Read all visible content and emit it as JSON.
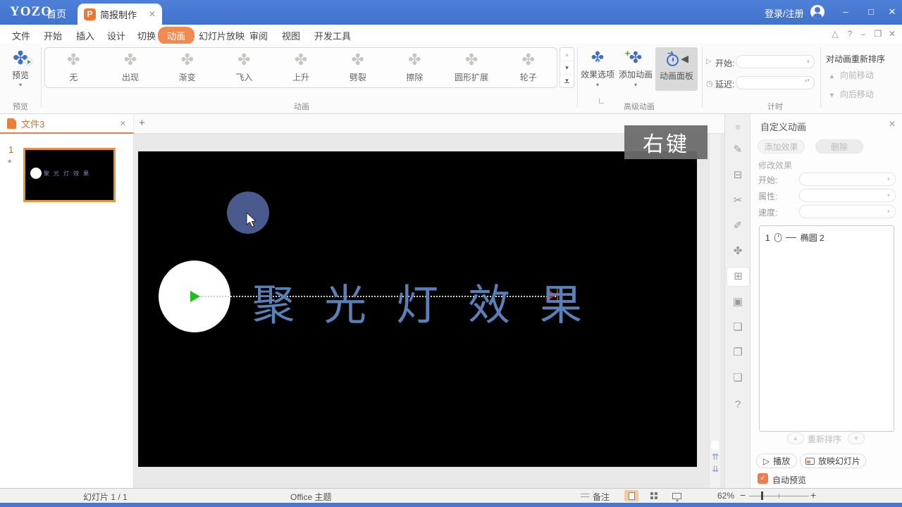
{
  "titlebar": {
    "logo": "YOZO",
    "home": "首页",
    "doc_tab": "简报制作",
    "login": "登录/注册"
  },
  "menubar": {
    "items": [
      "文件",
      "开始",
      "插入",
      "设计",
      "切换",
      "动画",
      "幻灯片放映",
      "审阅",
      "视图",
      "开发工具"
    ],
    "active_item": "动画"
  },
  "ribbon": {
    "preview_button": "预览",
    "preview_group": "预览",
    "gallery_items": [
      "无",
      "出现",
      "渐变",
      "飞入",
      "上升",
      "劈裂",
      "擦除",
      "圆形扩展",
      "轮子"
    ],
    "gallery_group": "动画",
    "effect_options": "效果选项",
    "add_animation": "添加动画",
    "animation_panel": "动画面板",
    "advanced_group": "高级动画",
    "start_label": "开始:",
    "delay_label": "延迟:",
    "timing_group": "计时",
    "reorder_title": "对动画重新排序",
    "move_forward": "向前移动",
    "move_backward": "向后移动"
  },
  "doc_tabbar": {
    "tab": "文件3"
  },
  "slide_panel": {
    "slide_number": "1",
    "thumb_text": "聚 光 灯 效 果"
  },
  "canvas": {
    "tooltip": "右键",
    "slide_text": "聚光灯效果"
  },
  "anim_panel": {
    "title": "自定义动画",
    "add_effect": "添加效果",
    "delete": "删除",
    "modify_label": "修改效果",
    "start_label": "开始:",
    "property_label": "属性:",
    "speed_label": "速度:",
    "list_item": {
      "order": "1",
      "name": "椭圆 2"
    },
    "reorder_label": "重新排序",
    "play": "播放",
    "slideshow": "放映幻灯片",
    "autopreview": "自动预览"
  },
  "statusbar": {
    "slide_info": "幻灯片 1 / 1",
    "theme": "Office 主题",
    "notes": "备注",
    "zoom": "62%"
  },
  "icons": {
    "pinwheel": "✤",
    "dropdown": "▾",
    "spinner": "▴▾",
    "scroll_up": "▲",
    "scroll_down": "▼",
    "move_up": "▲",
    "move_down": "▼",
    "play_outline": "▷",
    "clock": "◷",
    "double_up": "⇈",
    "double_down": "⇊",
    "close": "✕",
    "minimize": "–",
    "maximize": "□",
    "restore": "❐",
    "collapse": "△",
    "help": "?",
    "check": "✓",
    "plus": "+",
    "star": "✦",
    "speaker": "◀",
    "arrow": "➜",
    "new_tab": "+"
  },
  "side_toolbar": {
    "glyphs": [
      "≡",
      "✎",
      "⊟",
      "✂",
      "✐",
      "✤",
      "⊞",
      "▣",
      "❏",
      "❐",
      "❑",
      "?"
    ]
  },
  "colors": {
    "titlebar_blue": "#4678d2",
    "accent_orange": "#ee8a51",
    "slide_text_blue": "#5b80b8",
    "ellipse_blue": "#4a5a8c"
  }
}
